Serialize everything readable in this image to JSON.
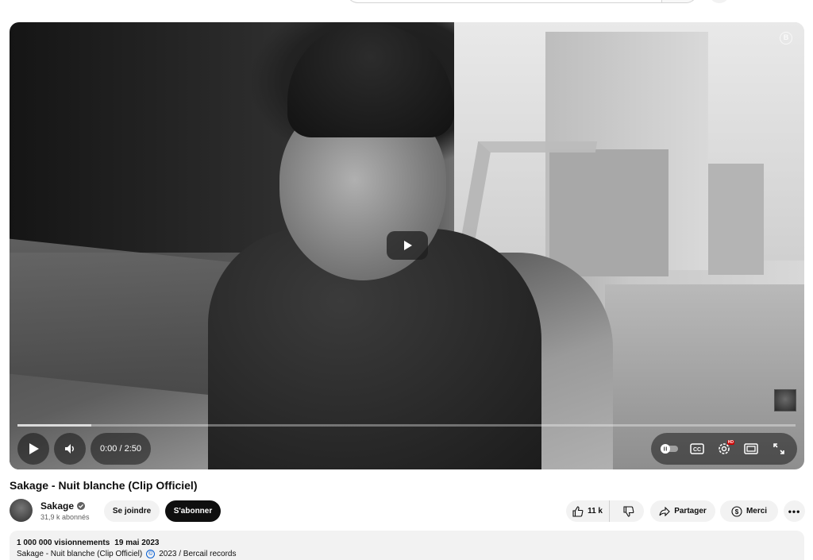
{
  "player": {
    "time_display": "0:00 / 2:50",
    "progress_played_fraction": 0.0,
    "progress_loaded_fraction": 0.095,
    "accent_color": "#ff0000",
    "quality_badge": "HD"
  },
  "video": {
    "title": "Sakage - Nuit blanche (Clip Officiel)"
  },
  "channel": {
    "name": "Sakage",
    "subscribers": "31,9 k abonnés",
    "join_label": "Se joindre",
    "subscribe_label": "S'abonner"
  },
  "actions": {
    "like_count": "11 k",
    "share_label": "Partager",
    "thanks_label": "Merci",
    "more_label": "•••"
  },
  "description": {
    "views": "1 000 000 visionnements",
    "date": "19 mai 2023",
    "line_title": "Sakage - Nuit blanche (Clip Officiel)",
    "copyright_symbol": "©",
    "line_rest": "2023 / Bercail records"
  },
  "icons": [
    "play-icon",
    "volume-icon",
    "autoplay-toggle-icon",
    "captions-icon",
    "settings-icon",
    "theater-icon",
    "fullscreen-icon",
    "like-icon",
    "dislike-icon",
    "share-icon",
    "thanks-icon",
    "verified-icon"
  ]
}
